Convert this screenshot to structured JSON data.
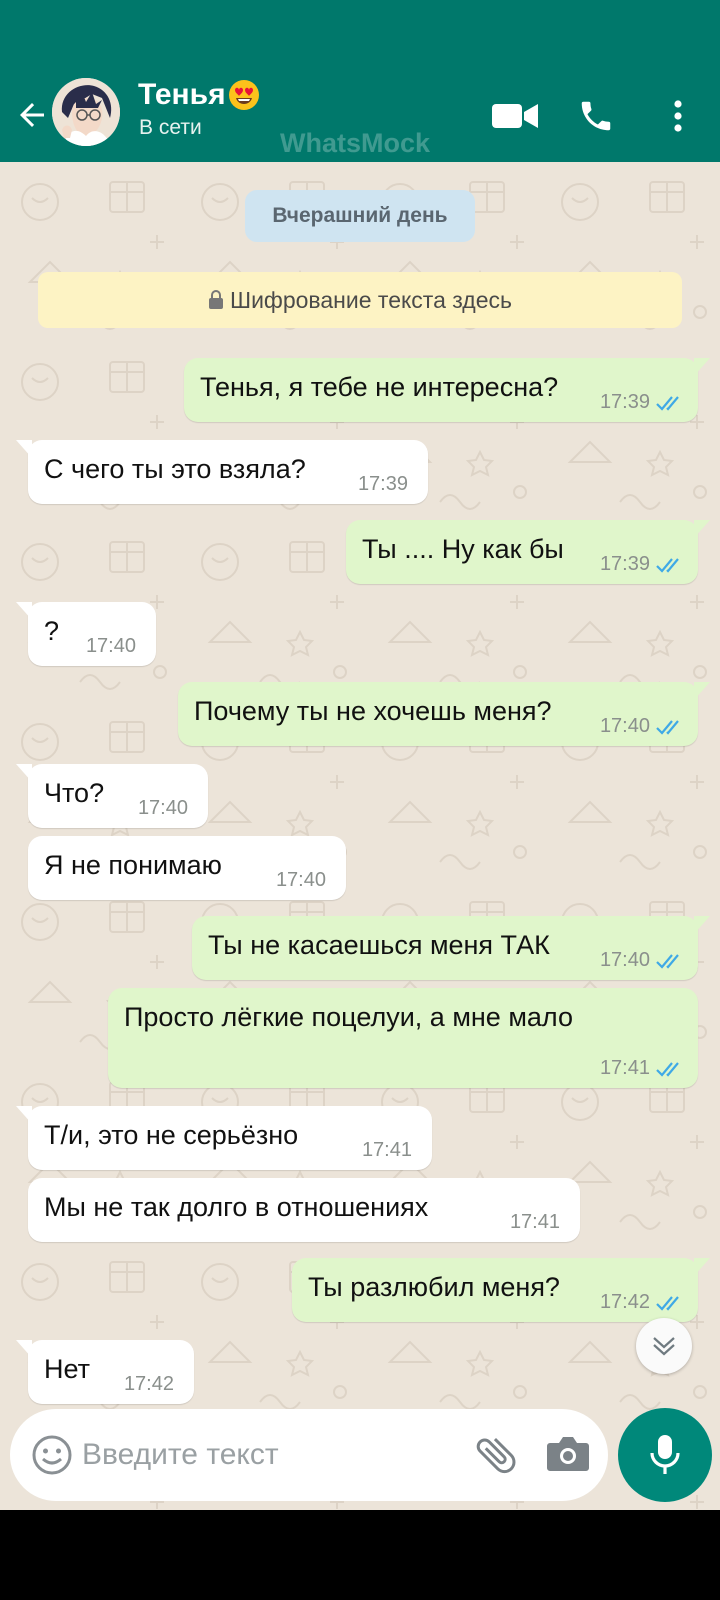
{
  "header": {
    "contact_name": "Тенья",
    "status": "В сети",
    "watermark": "WhatsMock"
  },
  "chat": {
    "date_label": "Вчерашний день",
    "encryption_notice": "Шифрование текста здесь",
    "messages": [
      {
        "dir": "out",
        "text": "Тенья, я тебе не интересна?",
        "time": "17:39",
        "read": true
      },
      {
        "dir": "in",
        "text": "С чего ты это взяла?",
        "time": "17:39"
      },
      {
        "dir": "out",
        "text": "Ты .... Ну как бы",
        "time": "17:39",
        "read": true
      },
      {
        "dir": "in",
        "text": "?",
        "time": "17:40"
      },
      {
        "dir": "out",
        "text": "Почему ты не хочешь меня?",
        "time": "17:40",
        "read": true
      },
      {
        "dir": "in",
        "text": "Что?",
        "time": "17:40"
      },
      {
        "dir": "in",
        "text": "Я не понимаю",
        "time": "17:40"
      },
      {
        "dir": "out",
        "text": "Ты не касаешься меня ТАК",
        "time": "17:40",
        "read": true
      },
      {
        "dir": "out",
        "text": "Просто лёгкие поцелуи, а мне мало",
        "time": "17:41",
        "read": true
      },
      {
        "dir": "in",
        "text": "Т/и, это не серьёзно",
        "time": "17:41"
      },
      {
        "dir": "in",
        "text": "Мы не так долго в отношениях",
        "time": "17:41"
      },
      {
        "dir": "out",
        "text": "Ты разлюбил меня?",
        "time": "17:42",
        "read": true
      },
      {
        "dir": "in",
        "text": "Нет",
        "time": "17:42"
      }
    ]
  },
  "composer": {
    "placeholder": "Введите текст"
  },
  "colors": {
    "header": "#00786b",
    "outgoing_bubble": "#e0f6cb",
    "incoming_bubble": "#ffffff",
    "chat_background": "#ece4d9",
    "read_ticks": "#3fa9e6",
    "mic_button": "#00887a"
  },
  "icons": [
    "back-arrow-icon",
    "video-call-icon",
    "phone-icon",
    "more-vert-icon",
    "lock-icon",
    "double-check-icon",
    "chevron-down-double-icon",
    "emoji-icon",
    "paperclip-icon",
    "camera-icon",
    "mic-icon"
  ]
}
